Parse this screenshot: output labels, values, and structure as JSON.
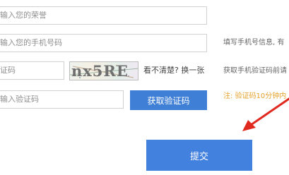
{
  "form": {
    "honor_placeholder": "输入您的荣誉",
    "phone_placeholder": "输入您的手机号码",
    "captcha_placeholder": "证码",
    "sms_code_placeholder": "输入验证码",
    "captcha_image_text": "nx5RE",
    "captcha_refresh": "看不清楚? 换一张",
    "get_code_button": "获取验证码",
    "submit_button": "提交"
  },
  "hints": {
    "phone_hint": "填写手机号信息, 有",
    "code_hint": "获取手机验证码前请",
    "warning_hint": "注: 验证码10分钟内"
  },
  "colors": {
    "primary_button": "#4381de",
    "warning_text": "#e5a12a",
    "annotation_arrow": "#e02a20"
  }
}
